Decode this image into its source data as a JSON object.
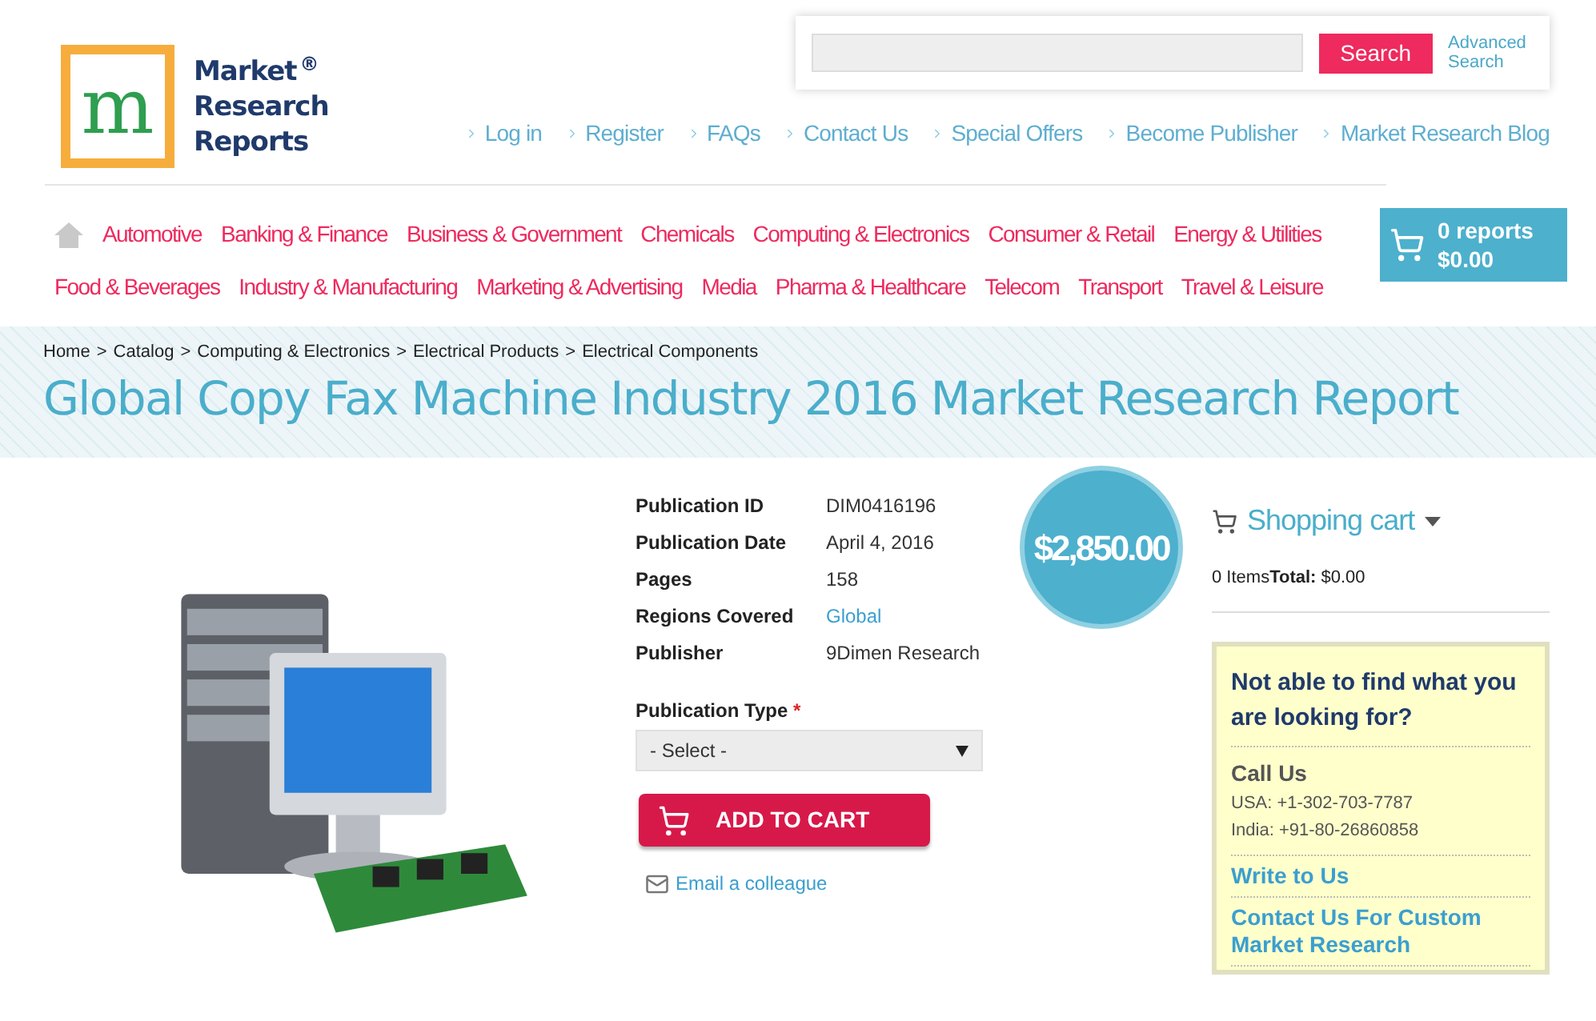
{
  "logo": {
    "mark": "m",
    "line1": "Market",
    "line2": "Research",
    "line3": "Reports",
    "registered": "®"
  },
  "search": {
    "button": "Search",
    "advanced": "Advanced Search"
  },
  "top_links": [
    "Log in",
    "Register",
    "FAQs",
    "Contact Us",
    "Special Offers",
    "Become Publisher",
    "Market Research Blog"
  ],
  "categories": [
    [
      "Automotive",
      "Banking & Finance",
      "Business & Government",
      "Chemicals",
      "Computing & Electronics",
      "Consumer & Retail",
      "Energy & Utilities"
    ],
    [
      "Food & Beverages",
      "Industry & Manufacturing",
      "Marketing & Advertising",
      "Media",
      "Pharma & Healthcare",
      "Telecom",
      "Transport",
      "Travel & Leisure"
    ]
  ],
  "header_cart": {
    "count": "0 reports",
    "total": "$0.00"
  },
  "breadcrumb_separator": ">",
  "breadcrumb": [
    "Home",
    "Catalog",
    "Computing & Electronics",
    "Electrical Products",
    "Electrical Components"
  ],
  "title": "Global Copy Fax Machine Industry 2016 Market Research Report",
  "details": [
    {
      "label": "Publication ID",
      "value": "DIM0416196",
      "link": false
    },
    {
      "label": "Publication Date",
      "value": "April 4, 2016",
      "link": false
    },
    {
      "label": "Pages",
      "value": "158",
      "link": false
    },
    {
      "label": "Regions Covered",
      "value": "Global",
      "link": true
    },
    {
      "label": "Publisher",
      "value": "9Dimen Research",
      "link": false
    }
  ],
  "publication_type": {
    "label": "Publication Type",
    "required": "*",
    "value": "- Select -"
  },
  "add_to_cart": "ADD TO CART",
  "email": "Email a colleague",
  "price": "$2,850.00",
  "shopping_cart": {
    "title": "Shopping cart",
    "items": "0 Items",
    "total_label": "Total:",
    "total": "$0.00"
  },
  "help": {
    "heading": "Not able to find what you are looking for?",
    "call": "Call Us",
    "phones": [
      "USA: +1-302-703-7787",
      "India: +91-80-26860858"
    ],
    "links": [
      "Write to Us",
      "Contact Us For Custom Market Research"
    ]
  }
}
